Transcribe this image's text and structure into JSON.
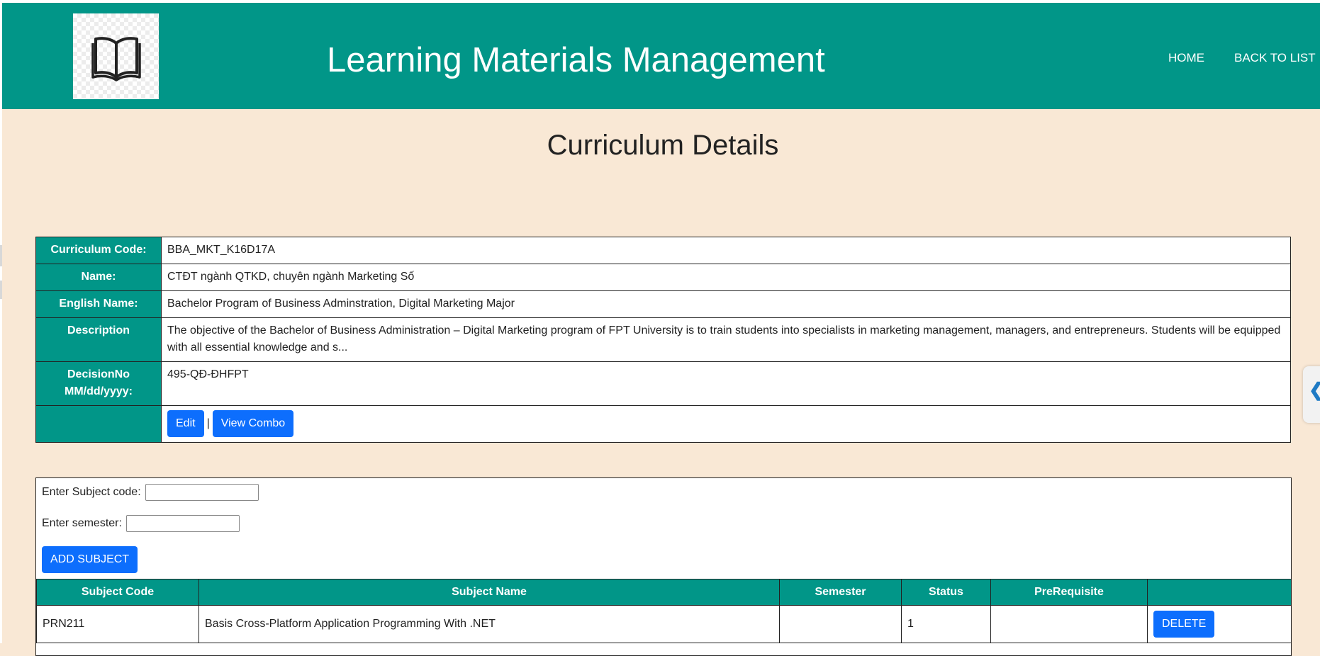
{
  "header": {
    "title": "Learning Materials Management",
    "logo_icon": "open-book-icon",
    "nav": {
      "home": "HOME",
      "back": "BACK TO LIST"
    }
  },
  "page": {
    "title": "Curriculum Details"
  },
  "details": {
    "rows": [
      {
        "label": "Curriculum Code:",
        "value": "BBA_MKT_K16D17A"
      },
      {
        "label": "Name:",
        "value": "CTĐT ngành QTKD, chuyên ngành Marketing Số"
      },
      {
        "label": "English Name:",
        "value": "Bachelor Program of Business Adminstration, Digital Marketing Major"
      },
      {
        "label": "Description",
        "value": "The objective of the Bachelor of Business Administration – Digital Marketing program of FPT University is to train students into specialists in marketing management, managers, and entrepreneurs. Students will be equipped with all essential knowledge and s..."
      },
      {
        "label": "DecisionNo MM/dd/yyyy:",
        "value": "495-QĐ-ĐHFPT"
      }
    ],
    "actions": {
      "edit": "Edit",
      "separator": "|",
      "view_combo": "View Combo"
    }
  },
  "subject_form": {
    "subject_code_label": "Enter Subject code:",
    "subject_code_value": "",
    "semester_label": "Enter semester:",
    "semester_value": "",
    "add_button": "ADD SUBJECT"
  },
  "subjects_table": {
    "headers": [
      "Subject Code",
      "Subject Name",
      "Semester",
      "Status",
      "PreRequisite",
      ""
    ],
    "rows": [
      {
        "code": "PRN211",
        "name": "Basis Cross-Platform Application Programming With .NET",
        "semester": "",
        "status": "1",
        "prerequisite": "",
        "action": "DELETE"
      }
    ]
  },
  "side_tab": {
    "icon": "chevron-left-icon",
    "glyph": "❮"
  },
  "colors": {
    "header": "#019688",
    "background": "#f9e8d5",
    "button": "#0d6efd"
  }
}
